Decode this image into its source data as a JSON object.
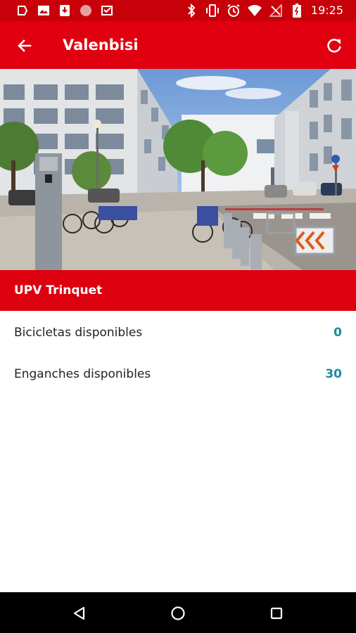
{
  "status_bar": {
    "time": "19:25",
    "left_icons": [
      "notification-icon",
      "image-icon",
      "download-icon",
      "record-icon",
      "inbox-icon"
    ],
    "right_icons": [
      "bluetooth-icon",
      "vibrate-icon",
      "alarm-icon",
      "wifi-icon",
      "no-signal-icon",
      "battery-icon"
    ]
  },
  "toolbar": {
    "title": "Valenbisi",
    "back_icon": "arrow-back-icon",
    "refresh_icon": "refresh-icon"
  },
  "station": {
    "name": "UPV Trinquet",
    "rows": [
      {
        "label": "Bicicletas disponibles",
        "value": "0"
      },
      {
        "label": "Enganches disponibles",
        "value": "30"
      }
    ]
  },
  "colors": {
    "status_bar": "#c8000a",
    "toolbar": "#e1000f",
    "station_bar": "#dd000f",
    "value_text": "#1e8a9a"
  },
  "navigation": {
    "icons": [
      "back-triangle-icon",
      "home-circle-icon",
      "recents-square-icon"
    ]
  }
}
